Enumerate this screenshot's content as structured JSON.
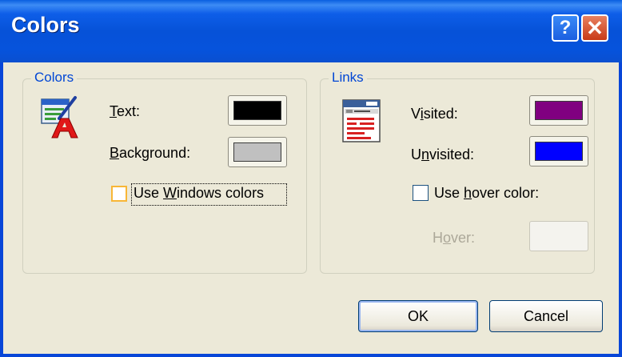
{
  "window": {
    "title": "Colors"
  },
  "titlebar": {
    "help_glyph": "?",
    "close_glyph": "✕"
  },
  "colors_group": {
    "legend": "Colors",
    "text_label_hotkey": "T",
    "text_label_rest": "ext:",
    "text_color": "#000000",
    "background_label_hotkey": "B",
    "background_label_rest": "ackground:",
    "background_color": "#c0c0c0",
    "use_windows_colors_prefix": "Use ",
    "use_windows_colors_hotkey": "W",
    "use_windows_colors_rest": "indows colors",
    "use_windows_colors_checked": false
  },
  "links_group": {
    "legend": "Links",
    "visited_label_prefix": "V",
    "visited_label_hotkey": "i",
    "visited_label_rest": "sited:",
    "visited_color": "#800080",
    "unvisited_label_prefix": "U",
    "unvisited_label_hotkey": "n",
    "unvisited_label_rest": "visited:",
    "unvisited_color": "#0000ff",
    "use_hover_prefix": "Use ",
    "use_hover_hotkey": "h",
    "use_hover_rest": "over color:",
    "use_hover_checked": false,
    "hover_label_prefix": "H",
    "hover_label_hotkey": "o",
    "hover_label_rest": "ver:"
  },
  "buttons": {
    "ok": "OK",
    "cancel": "Cancel"
  },
  "icons": [
    "colors-icon",
    "links-icon",
    "help-icon",
    "close-icon"
  ]
}
